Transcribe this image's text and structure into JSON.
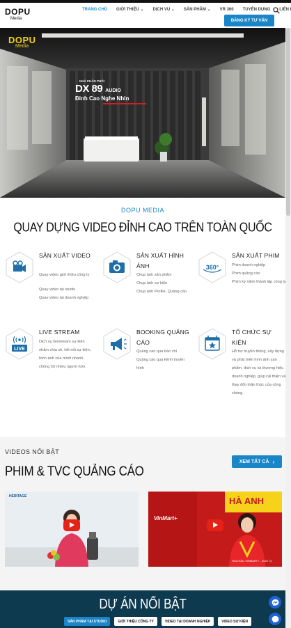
{
  "header": {
    "logo_main": "DOPU",
    "logo_sub": "Media",
    "nav": [
      "TRANG CHỦ",
      "GIỚI THIỆU ⌄",
      "DỊCH VỤ ⌄",
      "SẢN PHẨM ⌄",
      "VR 360",
      "TUYỂN DỤNG",
      "LIÊN HỆ"
    ],
    "cta": "ĐĂNG KÝ TƯ VẤN"
  },
  "hero": {
    "logo_main": "DOPU",
    "logo_sub": "Media",
    "sign_top": "NHÀ PHÂN PHỐI",
    "sign_brand": "DX 89",
    "sign_brand_suffix": "AUDIO",
    "sign_tagline": "Đỉnh Cao Nghe Nhìn"
  },
  "services_section": {
    "eyebrow": "DOPU MEDIA",
    "title": "QUAY DỰNG VIDEO ĐỈNH CAO TRÊN TOÀN QUỐC",
    "items": [
      {
        "title": "SẢN XUẤT VIDEO",
        "icon": "video-camera-icon",
        "desc": [
          "Quay video giới thiệu công ty",
          "Quay video tại studio",
          "Quay video tại doanh nghiệp"
        ]
      },
      {
        "title": "SẢN XUẤT HÌNH ẢNH",
        "icon": "photo-camera-icon",
        "desc": [
          "Chụp ảnh sản phẩm",
          "Chụp ảnh sự kiện",
          "Chụp ảnh Profile, Quảng cáo"
        ]
      },
      {
        "title": "SẢN XUẤT PHIM",
        "icon": "360-icon",
        "desc": [
          "Phim doanh nghiệp",
          "Phim quảng cáo",
          "Phim ký niệm thành lập công ty"
        ]
      },
      {
        "title": "LIVE STREAM",
        "icon": "live-icon",
        "desc": [
          "Dịch vụ livestream sự kiện nhằm chia sẻ, kết nối sự kiện, hình ảnh của mình nhanh chóng tới nhiều người hơn"
        ]
      },
      {
        "title": "BOOKING QUẢNG CÁO",
        "icon": "megaphone-icon",
        "desc": [
          "Quảng cáo qua báo chí",
          "Quảng cáo qua kênh truyền hình"
        ]
      },
      {
        "title": "TỔ CHỨC SỰ KIỆN",
        "icon": "calendar-star-icon",
        "desc": [
          "Hỗ trợ truyền thông, xây dựng và phát triển hình ảnh sản phẩm, dịch vụ và thương hiệu doanh nghiệp, giúp cải thiện và thay đổi nhận thức của công chúng."
        ]
      }
    ]
  },
  "videos_section": {
    "eyebrow": "VIDEOS NỔI BẬT",
    "title": "PHIM & TVC QUẢNG CÁO",
    "see_all": "XEM TẤT CẢ",
    "video1_logo": "HERITAGE",
    "video2_brand": "VinMart+",
    "video2_brand_right": "HÀ ANH",
    "video2_caption": "HOA HẬU VINMART+ - 2020 (?)"
  },
  "projects_section": {
    "title": "DỰ ÁN NỔI BẬT",
    "tabs": [
      "SẢN PHẨM TẠI STUDIO",
      "GIỚI THIỆU CÔNG TY",
      "VIDEO TẠI DOANH NGHIỆP",
      "VIDEO SỰ KIỆN"
    ]
  },
  "colors": {
    "accent": "#1a86c7",
    "project_bg": "#0d3a4f",
    "play": "#e62117"
  }
}
